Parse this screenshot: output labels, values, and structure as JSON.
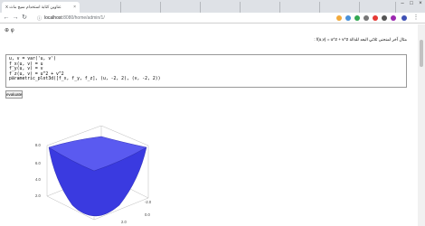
{
  "browser": {
    "active_tab_title": "X    عناوين كتابة استخدام سيج ماث",
    "inactive_tabs": [
      "",
      "",
      "",
      "",
      "",
      "",
      "",
      ""
    ],
    "url_host": "localhost",
    "url_path": ":8080/home/admin/1/"
  },
  "cell": {
    "toggle_label": "⊕ φ",
    "description": "مثال آخر لمنحنى ثلاثي البعد للدالة f(u,v) = u^2 + v^2 :",
    "code_lines": [
      "u, v = var('u, v')",
      "f_x(u, v) = u",
      "f_y(u, v) = v",
      "f_z(u, v) = u^2 + v^2",
      "parametric_plot3d([f_x, f_y, f_z], (u, -2, 2), (v, -2, 2))"
    ],
    "evaluate_label": "evaluate"
  },
  "plot": {
    "z_ticks": [
      "8.0",
      "6.0",
      "4.0",
      "2.0"
    ],
    "x_ticks": [
      "-2.0",
      "0.0",
      "2.0"
    ],
    "surface_color": "#3a3ae0"
  }
}
